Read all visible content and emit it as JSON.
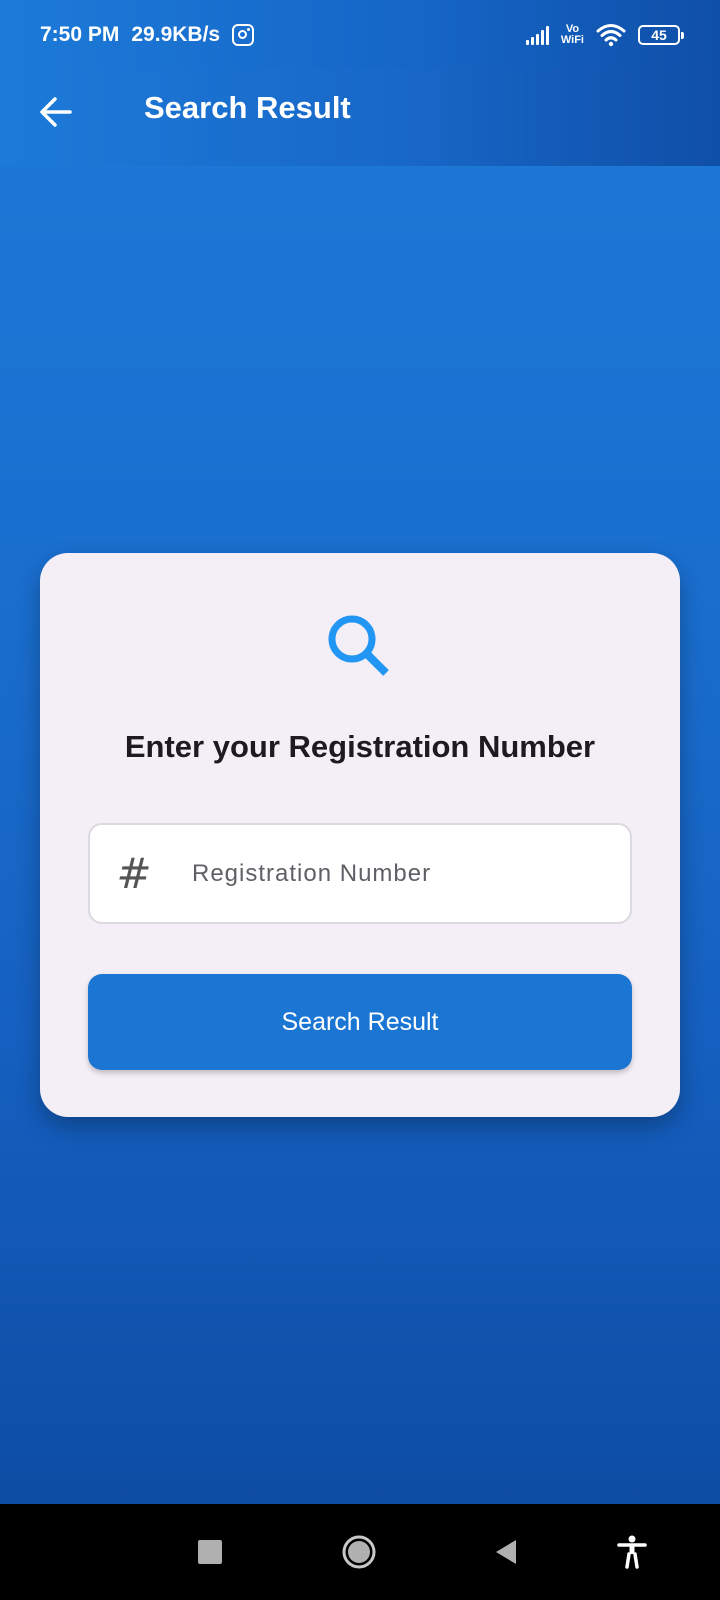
{
  "status_bar": {
    "time": "7:50 PM",
    "data_speed": "29.9KB/s",
    "vo_label": "Vo",
    "wifi_label": "WiFi",
    "battery_level": "45",
    "icons": [
      "instagram-icon",
      "signal-icon",
      "vowifi-icon",
      "wifi-icon",
      "battery-icon"
    ]
  },
  "app_bar": {
    "title": "Search Result",
    "back_icon": "arrow-left-icon"
  },
  "card": {
    "icon": "search-icon",
    "heading": "Enter your Registration Number",
    "field": {
      "prefix_symbol": "#",
      "placeholder": "Registration Number",
      "value": ""
    },
    "button_label": "Search Result"
  },
  "nav_bar": {
    "icons": [
      "recents-square-icon",
      "home-circle-icon",
      "back-triangle-icon",
      "accessibility-icon"
    ]
  },
  "colors": {
    "primary": "#1b76d3",
    "background_top": "#1d7ad8",
    "background_bottom": "#0b4498",
    "card": "#f4eff7",
    "search_icon": "#2196f3"
  }
}
